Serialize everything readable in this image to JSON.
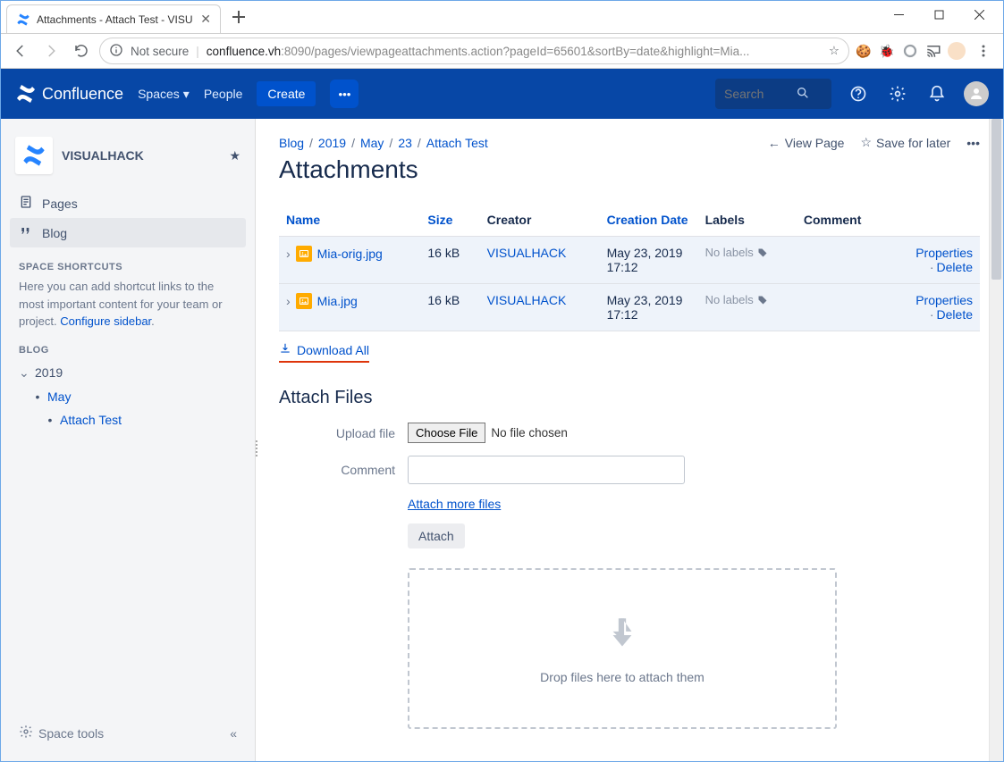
{
  "browser": {
    "tab_title": "Attachments - Attach Test - VISU",
    "security_label": "Not secure",
    "url_host": "confluence.vh",
    "url_path": ":8090/pages/viewpageattachments.action?pageId=65601&sortBy=date&highlight=Mia..."
  },
  "topnav": {
    "product": "Confluence",
    "spaces": "Spaces",
    "people": "People",
    "create": "Create",
    "search_placeholder": "Search"
  },
  "sidebar": {
    "space_name": "VISUALHACK",
    "pages": "Pages",
    "blog": "Blog",
    "shortcuts_head": "SPACE SHORTCUTS",
    "shortcuts_text": "Here you can add shortcut links to the most important content for your team or project.",
    "configure": "Configure sidebar",
    "blog_head": "BLOG",
    "tree": {
      "y2019": "2019",
      "may": "May",
      "attach_test": "Attach Test"
    },
    "space_tools": "Space tools"
  },
  "breadcrumbs": [
    "Blog",
    "2019",
    "May",
    "23",
    "Attach Test"
  ],
  "page_actions": {
    "view_page": "View Page",
    "save_later": "Save for later"
  },
  "page_title": "Attachments",
  "table": {
    "headers": {
      "name": "Name",
      "size": "Size",
      "creator": "Creator",
      "creation_date": "Creation Date",
      "labels": "Labels",
      "comment": "Comment"
    },
    "rows": [
      {
        "name": "Mia-orig.jpg",
        "size": "16 kB",
        "creator": "VISUALHACK",
        "date": "May 23, 2019 17:12",
        "labels": "No labels"
      },
      {
        "name": "Mia.jpg",
        "size": "16 kB",
        "creator": "VISUALHACK",
        "date": "May 23, 2019 17:12",
        "labels": "No labels"
      }
    ],
    "properties": "Properties",
    "delete": "Delete"
  },
  "download_all": "Download All",
  "attach_section": {
    "title": "Attach Files",
    "upload_label": "Upload file",
    "choose_file": "Choose File",
    "no_file": "No file chosen",
    "comment_label": "Comment",
    "attach_more": "Attach more files",
    "attach_btn": "Attach",
    "drop_text": "Drop files here to attach them"
  }
}
